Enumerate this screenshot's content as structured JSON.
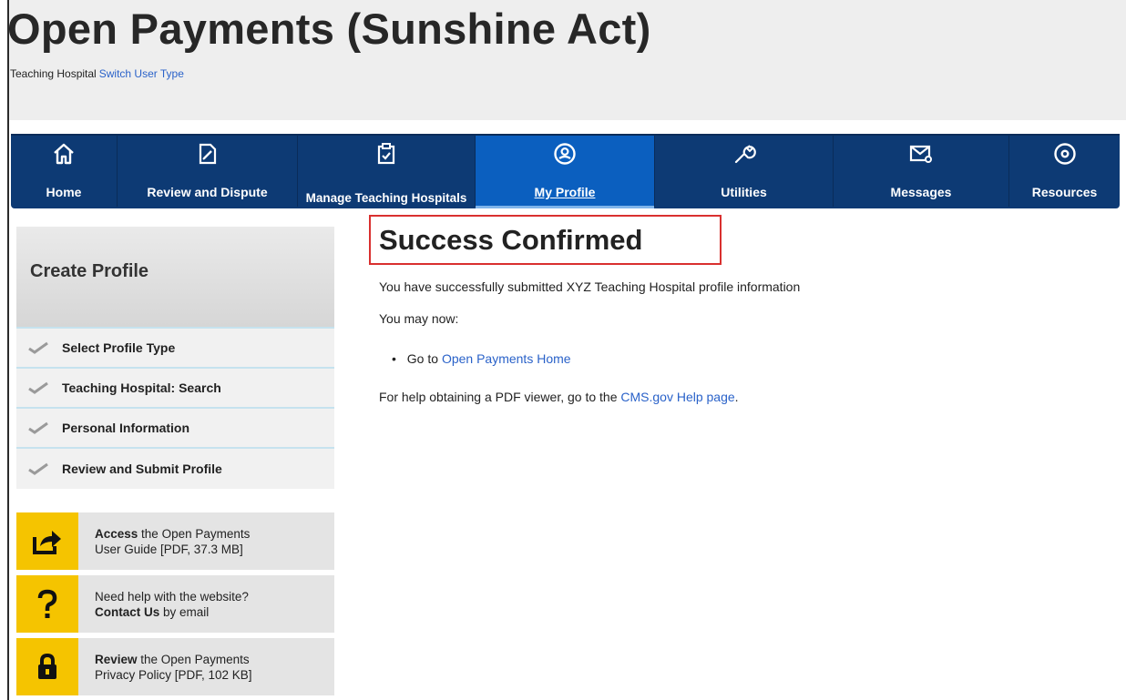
{
  "header": {
    "title": "Open Payments (Sunshine Act)",
    "user_type": "Teaching Hospital",
    "switch_link": "Switch User Type"
  },
  "nav": {
    "items": [
      {
        "label": "Home",
        "icon": "home-icon"
      },
      {
        "label": "Review and Dispute",
        "icon": "edit-icon"
      },
      {
        "label": "Manage Teaching Hospitals",
        "icon": "clipboard-icon"
      },
      {
        "label": "My Profile",
        "icon": "profile-icon",
        "active": true
      },
      {
        "label": "Utilities",
        "icon": "wrench-icon"
      },
      {
        "label": "Messages",
        "icon": "envelope-icon"
      },
      {
        "label": "Resources",
        "icon": "gear-icon"
      }
    ]
  },
  "sidebar": {
    "title": "Create Profile",
    "steps": [
      {
        "label": "Select Profile Type",
        "icon": "checkmark-icon"
      },
      {
        "label": "Teaching Hospital: Search",
        "icon": "checkmark-icon"
      },
      {
        "label": "Personal Information",
        "icon": "checkmark-icon"
      },
      {
        "label": "Review and Submit Profile",
        "icon": "checkmark-icon"
      }
    ],
    "help": {
      "guide": {
        "bold": "Access",
        "line1": " the Open Payments",
        "line2": "User Guide [PDF, 37.3 MB]",
        "icon": "share-arrow-icon"
      },
      "contact": {
        "line1": "Need help with the website?",
        "bold": "Contact Us",
        "line2": " by email",
        "icon": "question-icon"
      },
      "privacy": {
        "bold": "Review",
        "line1": " the Open Payments",
        "line2": "Privacy Policy [PDF, 102 KB]",
        "icon": "lock-icon"
      }
    }
  },
  "main": {
    "title": "Success Confirmed",
    "message": "You have successfully submitted XYZ Teaching Hospital profile information",
    "may_now": "You may now:",
    "goto_prefix": "Go to ",
    "goto_link": "Open Payments Home",
    "pdf_prefix": "For help obtaining a PDF viewer, go to the ",
    "pdf_link": "CMS.gov Help page",
    "pdf_suffix": "."
  },
  "colors": {
    "nav_bg": "#0d3a74",
    "nav_active": "#0b5fbf",
    "link": "#2a62c9",
    "highlight_border": "#d9302f",
    "help_icon_bg": "#f5c400"
  }
}
